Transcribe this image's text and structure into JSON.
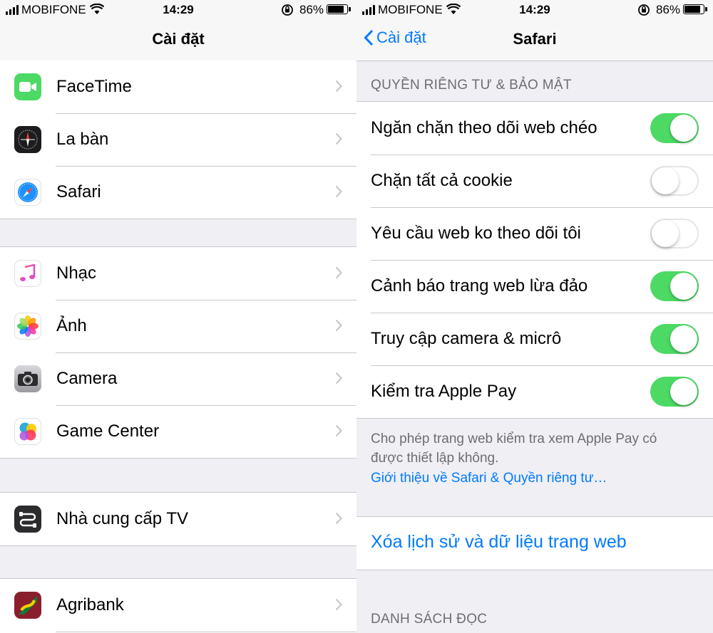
{
  "status_bar": {
    "carrier": "MOBIFONE",
    "time": "14:29",
    "battery_pct": "86%",
    "battery_level": 0.86
  },
  "left": {
    "nav_title": "Cài đặt",
    "groups": [
      [
        {
          "label": "FaceTime",
          "icon": "facetime-icon"
        },
        {
          "label": "La bàn",
          "icon": "compass-icon"
        },
        {
          "label": "Safari",
          "icon": "safari-icon"
        }
      ],
      [
        {
          "label": "Nhạc",
          "icon": "music-icon"
        },
        {
          "label": "Ảnh",
          "icon": "photos-icon"
        },
        {
          "label": "Camera",
          "icon": "camera-icon"
        },
        {
          "label": "Game Center",
          "icon": "game-center-icon"
        }
      ],
      [
        {
          "label": "Nhà cung cấp TV",
          "icon": "tv-provider-icon"
        }
      ],
      [
        {
          "label": "Agribank",
          "icon": "agribank-icon"
        }
      ]
    ]
  },
  "right": {
    "nav_title": "Safari",
    "back_label": "Cài đặt",
    "section_privacy": "QUYỀN RIÊNG TƯ & BẢO MẬT",
    "settings": [
      {
        "label": "Ngăn chặn theo dõi web chéo",
        "on": true
      },
      {
        "label": "Chặn tất cả cookie",
        "on": false
      },
      {
        "label": "Yêu cầu web ko theo dõi tôi",
        "on": false
      },
      {
        "label": "Cảnh báo trang web lừa đảo",
        "on": true
      },
      {
        "label": "Truy cập camera & micrô",
        "on": true
      },
      {
        "label": "Kiểm tra Apple Pay",
        "on": true
      }
    ],
    "footer_note": "Cho phép trang web kiểm tra xem Apple Pay có được thiết lập không.",
    "footer_link": "Giới thiệu về Safari & Quyền riêng tư…",
    "clear_history": "Xóa lịch sử và dữ liệu trang web",
    "section_reading": "DANH SÁCH ĐỌC"
  },
  "colors": {
    "accent": "#007aff",
    "toggle_on": "#4cd964",
    "facetime": "#4cd964"
  }
}
